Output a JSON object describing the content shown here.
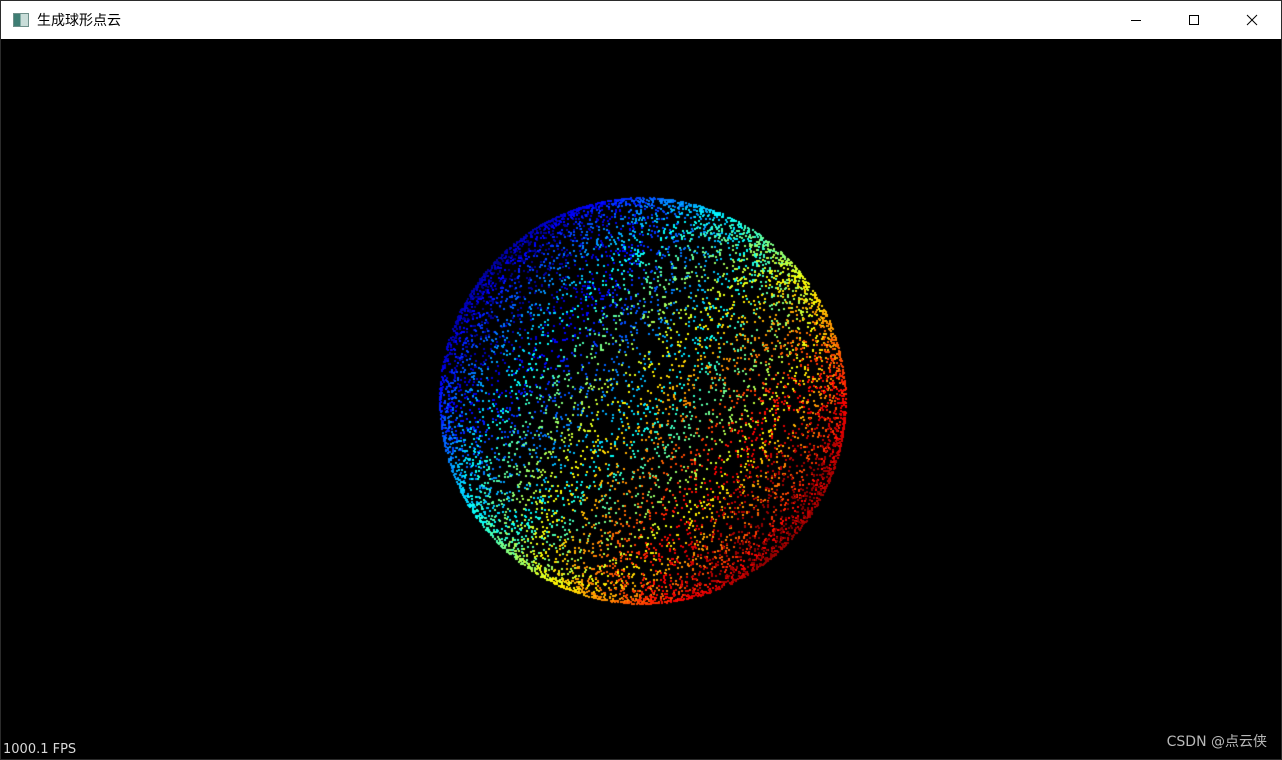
{
  "window": {
    "title": "生成球形点云",
    "icons": {
      "app": "app-icon",
      "minimize": "minimize-icon",
      "maximize": "maximize-icon",
      "close": "close-icon"
    }
  },
  "viewer": {
    "background": "#000000",
    "fps_text": "1000.1 FPS",
    "watermark": "CSDN @点云侠",
    "colormap": "jet"
  }
}
